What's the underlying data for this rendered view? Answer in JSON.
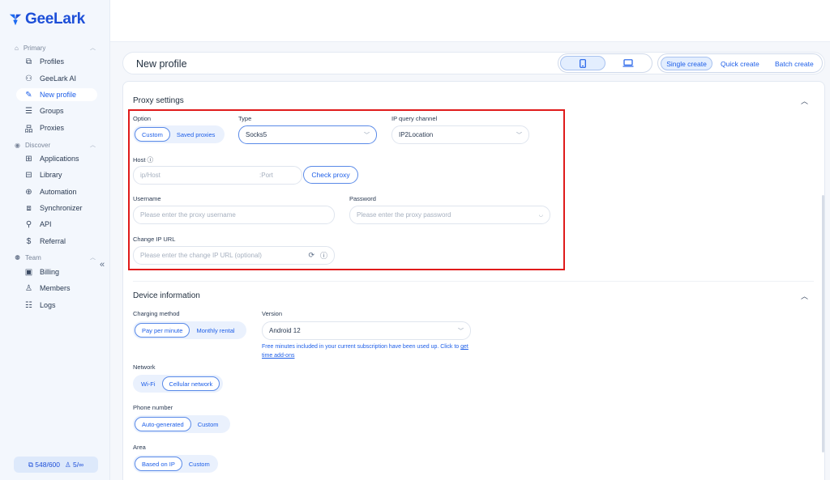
{
  "app": {
    "logo_text": "GeeLark",
    "brand_color": "#1d5ee8"
  },
  "sidebar": {
    "sections": [
      {
        "label": "Primary",
        "icon": "home-icon"
      },
      {
        "label": "Discover",
        "icon": "eye-icon"
      },
      {
        "label": "Team",
        "icon": "users-icon"
      }
    ],
    "items": [
      {
        "label": "Profiles",
        "icon": "profiles-icon"
      },
      {
        "label": "GeeLark AI",
        "icon": "ai-icon"
      },
      {
        "label": "New profile",
        "icon": "edit-icon",
        "active": true
      },
      {
        "label": "Groups",
        "icon": "list-icon"
      },
      {
        "label": "Proxies",
        "icon": "proxy-icon"
      },
      {
        "label": "Applications",
        "icon": "grid-icon"
      },
      {
        "label": "Library",
        "icon": "library-icon"
      },
      {
        "label": "Automation",
        "icon": "robot-icon"
      },
      {
        "label": "Synchronizer",
        "icon": "sync-icon"
      },
      {
        "label": "API",
        "icon": "api-icon"
      },
      {
        "label": "Referral",
        "icon": "dollar-icon"
      },
      {
        "label": "Billing",
        "icon": "billing-icon"
      },
      {
        "label": "Members",
        "icon": "person-icon"
      },
      {
        "label": "Logs",
        "icon": "logs-icon"
      }
    ],
    "collapse": "«",
    "quota": {
      "profiles": "548/600",
      "members": "5/∞"
    }
  },
  "header": {
    "title": "New profile",
    "device_options": [
      "phone-icon",
      "laptop-icon"
    ],
    "modes": [
      "Single create",
      "Quick create",
      "Batch create"
    ],
    "selected_mode": "Single create"
  },
  "proxy": {
    "title": "Proxy settings",
    "option_label": "Option",
    "options": [
      "Custom",
      "Saved proxies"
    ],
    "type_label": "Type",
    "type_value": "Socks5",
    "ip_channel_label": "IP query channel",
    "ip_channel_value": "IP2Location",
    "host_label": "Host",
    "host_placeholder": "ip/Host",
    "port_placeholder": "Port",
    "check_proxy": "Check proxy",
    "username_label": "Username",
    "username_placeholder": "Please enter the proxy username",
    "password_label": "Password",
    "password_placeholder": "Please enter the proxy password",
    "change_ip_label": "Change IP URL",
    "change_ip_placeholder": "Please enter the change IP URL (optional)"
  },
  "device": {
    "title": "Device information",
    "charging_label": "Charging method",
    "charging_options": [
      "Pay per minute",
      "Monthly rental"
    ],
    "version_label": "Version",
    "version_value": "Android 12",
    "note": "Free minutes included in your current subscription have been used up. Click to",
    "note_link": "get time add-ons",
    "network_label": "Network",
    "network_options": [
      "Wi-Fi",
      "Cellular network"
    ],
    "phone_label": "Phone number",
    "phone_options": [
      "Auto-generated",
      "Custom"
    ],
    "area_label": "Area",
    "area_options": [
      "Based on IP",
      "Custom"
    ]
  }
}
